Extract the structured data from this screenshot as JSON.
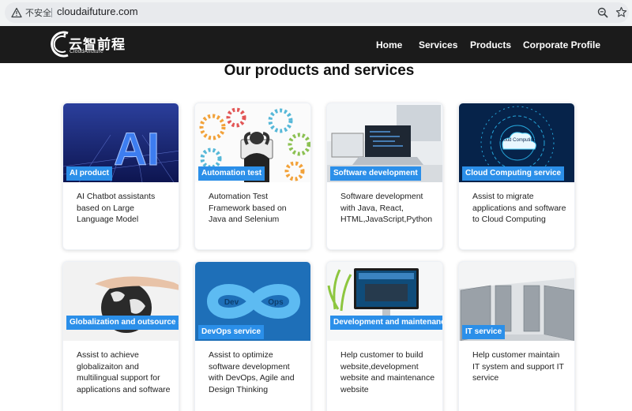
{
  "browser": {
    "security_label": "不安全",
    "url": "cloudaifuture.com",
    "icons": [
      "warning-icon",
      "zoom-icon",
      "bookmark-star-icon"
    ]
  },
  "header": {
    "logo_text": "云智前程",
    "logo_subtext": "CloudAIfuture",
    "nav": [
      "Home",
      "Services",
      "Products",
      "Corporate Profile"
    ]
  },
  "main": {
    "title": "Our products and services",
    "cards": [
      {
        "tag": "AI product",
        "desc": "AI Chatbot assistants based on Large Language Model"
      },
      {
        "tag": "Automation test",
        "desc": "Automation Test Framework based on Java and Selenium"
      },
      {
        "tag": "Software development",
        "desc": "Software development with Java, React, HTML,JavaScript,Python"
      },
      {
        "tag": "Cloud Computing service",
        "desc": "Assist to migrate applications and software to Cloud Computing"
      },
      {
        "tag": "Globalization and outsource service",
        "desc": "Assist to achieve globalizaiton and multilingual support for applications and software"
      },
      {
        "tag": "DevOps service",
        "desc": "Assist to optimize software development with DevOps, Agile and Design Thinking"
      },
      {
        "tag": "Development and maintenance of website",
        "desc": "Help customer to build website,development website and maintenance website"
      },
      {
        "tag": "IT service",
        "desc": "Help customer maintain IT system and support IT service"
      }
    ],
    "image_labels": {
      "ai": "AI",
      "cloud": "Cloud Computing",
      "dev": "Dev",
      "ops": "Ops"
    }
  },
  "colors": {
    "navbar": "#1b1b1b",
    "tag": "#2b8fe9",
    "addressbar": "#f1f3f4"
  }
}
